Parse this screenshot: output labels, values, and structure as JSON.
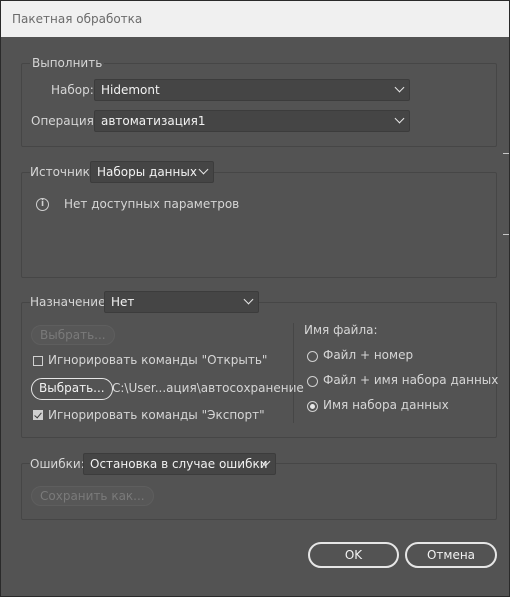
{
  "title": "Пакетная обработка",
  "run": {
    "legend": "Выполнить",
    "set_label": "Набор:",
    "set_value": "Hidemont",
    "operation_label": "Операция:",
    "operation_value": "автоматизация1"
  },
  "source": {
    "label": "Источник:",
    "value": "Наборы данных",
    "info_text": "Нет доступных параметров",
    "info_icon": "info-icon"
  },
  "destination": {
    "label": "Назначение:",
    "value": "Нет",
    "choose_disabled": "Выбрать...",
    "ignore_open_label": "Игнорировать команды \"Открыть\"",
    "ignore_open_checked": false,
    "choose_button": "Выбрать...",
    "path": "C:\\User...ация\\автосохранение",
    "ignore_export_label": "Игнорировать команды \"Экспорт\"",
    "ignore_export_checked": true,
    "filename_label": "Имя файла:",
    "filename_options": [
      {
        "label": "Файл + номер",
        "selected": false
      },
      {
        "label": "Файл + имя набора данных",
        "selected": false
      },
      {
        "label": "Имя набора данных",
        "selected": true
      }
    ]
  },
  "errors": {
    "label": "Ошибки:",
    "value": "Остановка в случае ошибки",
    "save_as": "Сохранить как..."
  },
  "buttons": {
    "ok": "OK",
    "cancel": "Отмена"
  }
}
